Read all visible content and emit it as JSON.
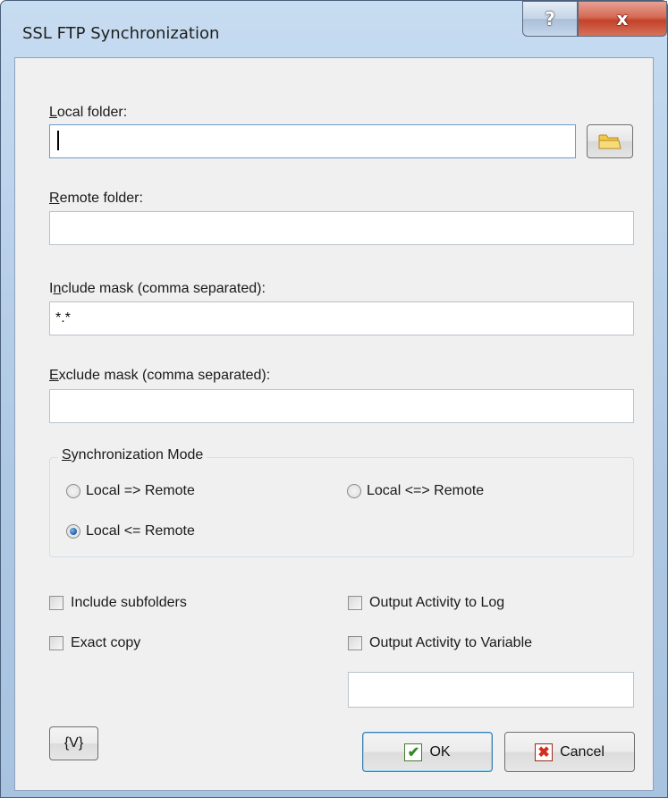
{
  "window": {
    "title": "SSL FTP Synchronization",
    "help_glyph": "?",
    "close_glyph": "x"
  },
  "local_folder": {
    "label_accel": "L",
    "label_rest": "ocal folder:",
    "value": ""
  },
  "remote_folder": {
    "label_accel": "R",
    "label_rest": "emote folder:",
    "value": ""
  },
  "include_mask": {
    "label_pre": "I",
    "label_accel": "n",
    "label_rest": "clude mask (comma separated):",
    "value": "*.*"
  },
  "exclude_mask": {
    "label_accel": "E",
    "label_rest": "xclude mask (comma separated):",
    "value": ""
  },
  "sync_mode": {
    "title_accel": "S",
    "title_rest": "ynchronization Mode",
    "options": [
      {
        "label": "Local => Remote",
        "selected": false
      },
      {
        "label": "Local <=> Remote",
        "selected": false
      },
      {
        "label": "Local <= Remote",
        "selected": true
      }
    ]
  },
  "checkboxes": {
    "include_subfolders": {
      "label": "Include subfolders",
      "checked": false
    },
    "exact_copy": {
      "label": "Exact copy",
      "checked": false
    },
    "output_log": {
      "label": "Output Activity to Log",
      "checked": false
    },
    "output_variable": {
      "label": "Output Activity to Variable",
      "checked": false
    }
  },
  "variable_field": {
    "value": ""
  },
  "buttons": {
    "variables": "{V}",
    "ok": "OK",
    "cancel": "Cancel"
  },
  "icons": {
    "browse": "folder-icon",
    "ok": "checkmark-icon",
    "cancel": "x-icon"
  }
}
